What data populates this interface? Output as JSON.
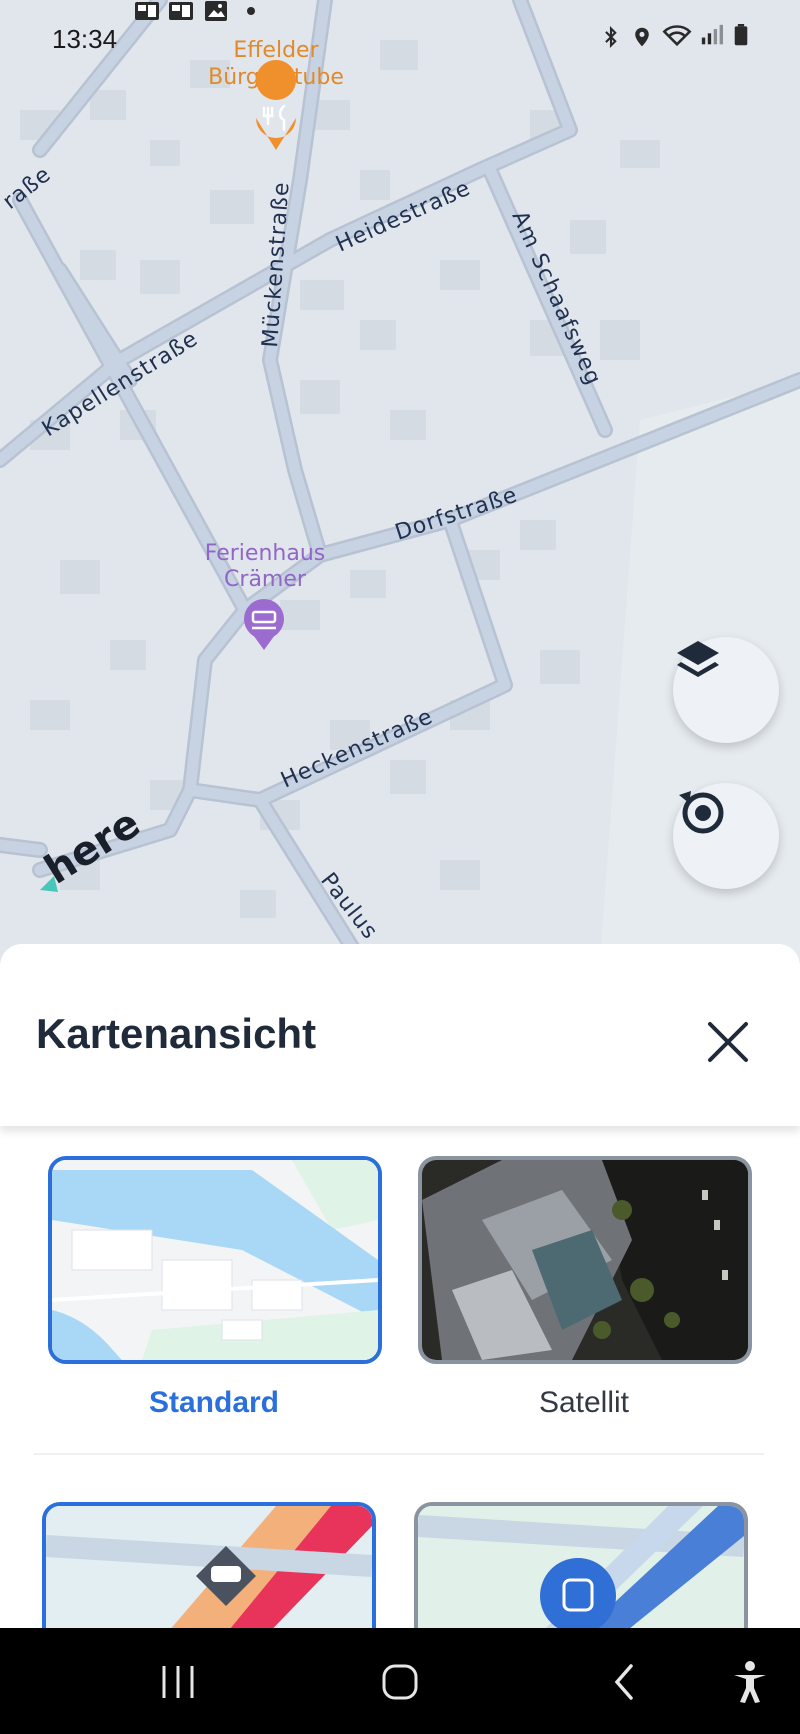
{
  "status_bar": {
    "time": "13:34"
  },
  "map": {
    "pois": [
      {
        "name_line1": "Effelder",
        "name_line2": "Bürgerstube",
        "icon": "restaurant-icon",
        "color": "#f0902c"
      },
      {
        "name_line1": "Ferienhaus",
        "name_line2": "Crämer",
        "icon": "hotel-icon",
        "color": "#9966cc"
      }
    ],
    "streets": [
      "raße",
      "Heidestraße",
      "Mückenstraße",
      "Am Schaafsweg",
      "Kapellenstraße",
      "Dorfstraße",
      "Heckenstraße",
      "Paulus"
    ],
    "logo": "here",
    "layers_button": "layers-icon",
    "locate_button": "locate-icon"
  },
  "sheet": {
    "title": "Kartenansicht",
    "options": [
      {
        "label": "Standard",
        "selected": true
      },
      {
        "label": "Satellit",
        "selected": false
      }
    ]
  },
  "colors": {
    "accent": "#2a6fdb",
    "map_background": "#e1e6ec",
    "road": "#c3cede",
    "street_label": "#1f3050"
  }
}
